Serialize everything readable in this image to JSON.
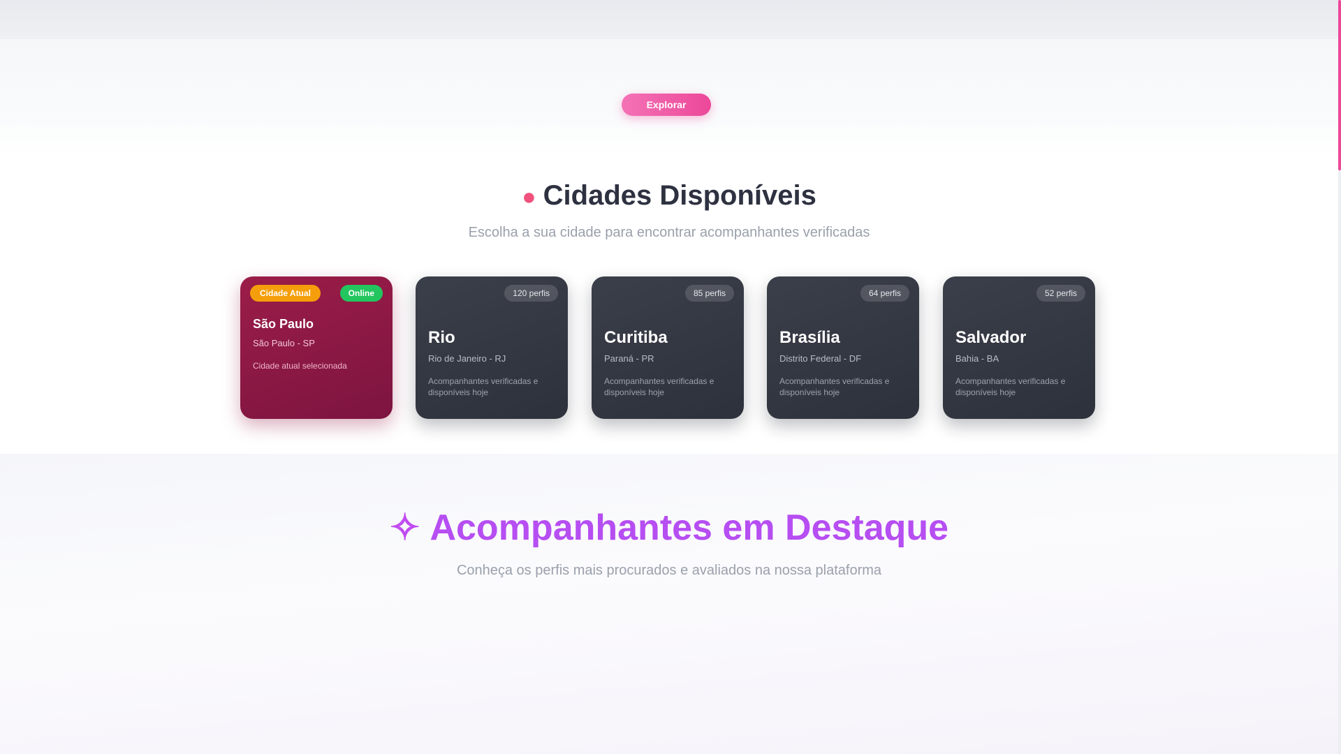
{
  "hero": {
    "cta_label": "Explorar"
  },
  "cities_section": {
    "title": "Cidades Disponíveis",
    "subtitle": "Escolha a sua cidade para encontrar acompanhantes verificadas",
    "pin_icon": "map-pin-icon"
  },
  "cities": [
    {
      "name": "São Paulo",
      "state": "São Paulo - SP",
      "desc": "Cidade atual selecionada",
      "current_badge": "Cidade Atual",
      "online_badge": "Online",
      "active": true
    },
    {
      "name": "Rio",
      "state": "Rio de Janeiro - RJ",
      "desc": "Acompanhantes verificadas e disponíveis hoje",
      "count_badge": "120 perfis",
      "active": false
    },
    {
      "name": "Curitiba",
      "state": "Paraná - PR",
      "desc": "Acompanhantes verificadas e disponíveis hoje",
      "count_badge": "85 perfis",
      "active": false
    },
    {
      "name": "Brasília",
      "state": "Distrito Federal - DF",
      "desc": "Acompanhantes verificadas e disponíveis hoje",
      "count_badge": "64 perfis",
      "active": false
    },
    {
      "name": "Salvador",
      "state": "Bahia - BA",
      "desc": "Acompanhantes verificadas e disponíveis hoje",
      "count_badge": "52 perfis",
      "active": false
    }
  ],
  "featured_section": {
    "title": "Acompanhantes em Destaque",
    "subtitle": "Conheça os perfis mais procurados e avaliados na nossa plataforma",
    "spark_icon": "sparkle-icon"
  },
  "colors": {
    "accent": "#ec4899",
    "active_card": "#8e1a45",
    "card": "#353944",
    "featured_title": "#b64ef2",
    "current_badge": "#f59e0b",
    "online_badge": "#22c55e"
  }
}
